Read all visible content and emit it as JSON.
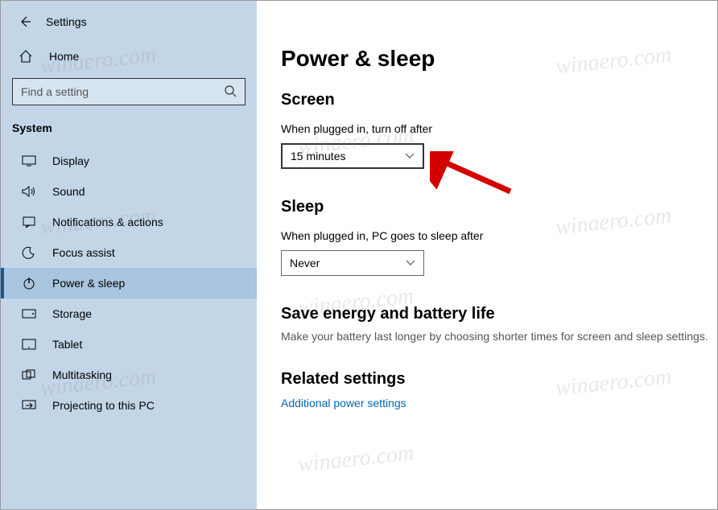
{
  "header": {
    "settings_label": "Settings",
    "home_label": "Home",
    "search_placeholder": "Find a setting",
    "category": "System"
  },
  "sidebar": {
    "items": [
      {
        "icon": "display",
        "label": "Display"
      },
      {
        "icon": "sound",
        "label": "Sound"
      },
      {
        "icon": "notifications",
        "label": "Notifications & actions"
      },
      {
        "icon": "focus",
        "label": "Focus assist"
      },
      {
        "icon": "power",
        "label": "Power & sleep"
      },
      {
        "icon": "storage",
        "label": "Storage"
      },
      {
        "icon": "tablet",
        "label": "Tablet"
      },
      {
        "icon": "multitasking",
        "label": "Multitasking"
      },
      {
        "icon": "projecting",
        "label": "Projecting to this PC"
      }
    ],
    "selected_index": 4
  },
  "main": {
    "title": "Power & sleep",
    "screen": {
      "heading": "Screen",
      "label": "When plugged in, turn off after",
      "value": "15 minutes"
    },
    "sleep": {
      "heading": "Sleep",
      "label": "When plugged in, PC goes to sleep after",
      "value": "Never"
    },
    "energy": {
      "heading": "Save energy and battery life",
      "text": "Make your battery last longer by choosing shorter times for screen and sleep settings."
    },
    "related": {
      "heading": "Related settings",
      "link": "Additional power settings"
    }
  },
  "watermark_text": "winaero.com"
}
